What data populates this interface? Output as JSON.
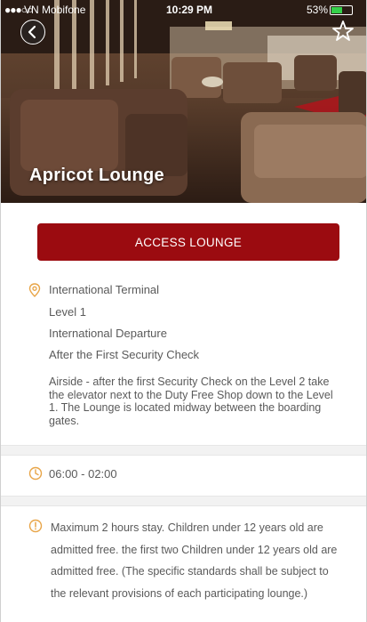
{
  "status_bar": {
    "signal": "●●●○○",
    "carrier": "VN Mobifone",
    "time": "10:29 PM",
    "battery": "53%"
  },
  "header": {
    "title": "Apricot Lounge",
    "back_icon": "chevron-left-icon",
    "favorite_icon": "star-outline-icon"
  },
  "actions": {
    "access_label": "ACCESS LOUNGE"
  },
  "location": {
    "icon": "map-pin-icon",
    "lines": [
      "International Terminal",
      "Level 1",
      "International Departure",
      "After the First Security Check"
    ],
    "directions": "Airside - after the first Security Check on the Level 2 take the elevator next to the Duty Free Shop down to the Level 1. The Lounge is located midway between the boarding gates."
  },
  "hours": {
    "icon": "clock-icon",
    "value": "06:00 - 02:00"
  },
  "conditions": {
    "icon": "info-circle-icon",
    "text": "Maximum 2 hours stay. Children under 12 years old are admitted free. the first two Children under 12 years old are admitted free. (The specific standards shall be subject to the relevant provisions of each participating lounge.)"
  },
  "colors": {
    "accent": "#9b0b10",
    "icon_orange": "#e8a548"
  }
}
